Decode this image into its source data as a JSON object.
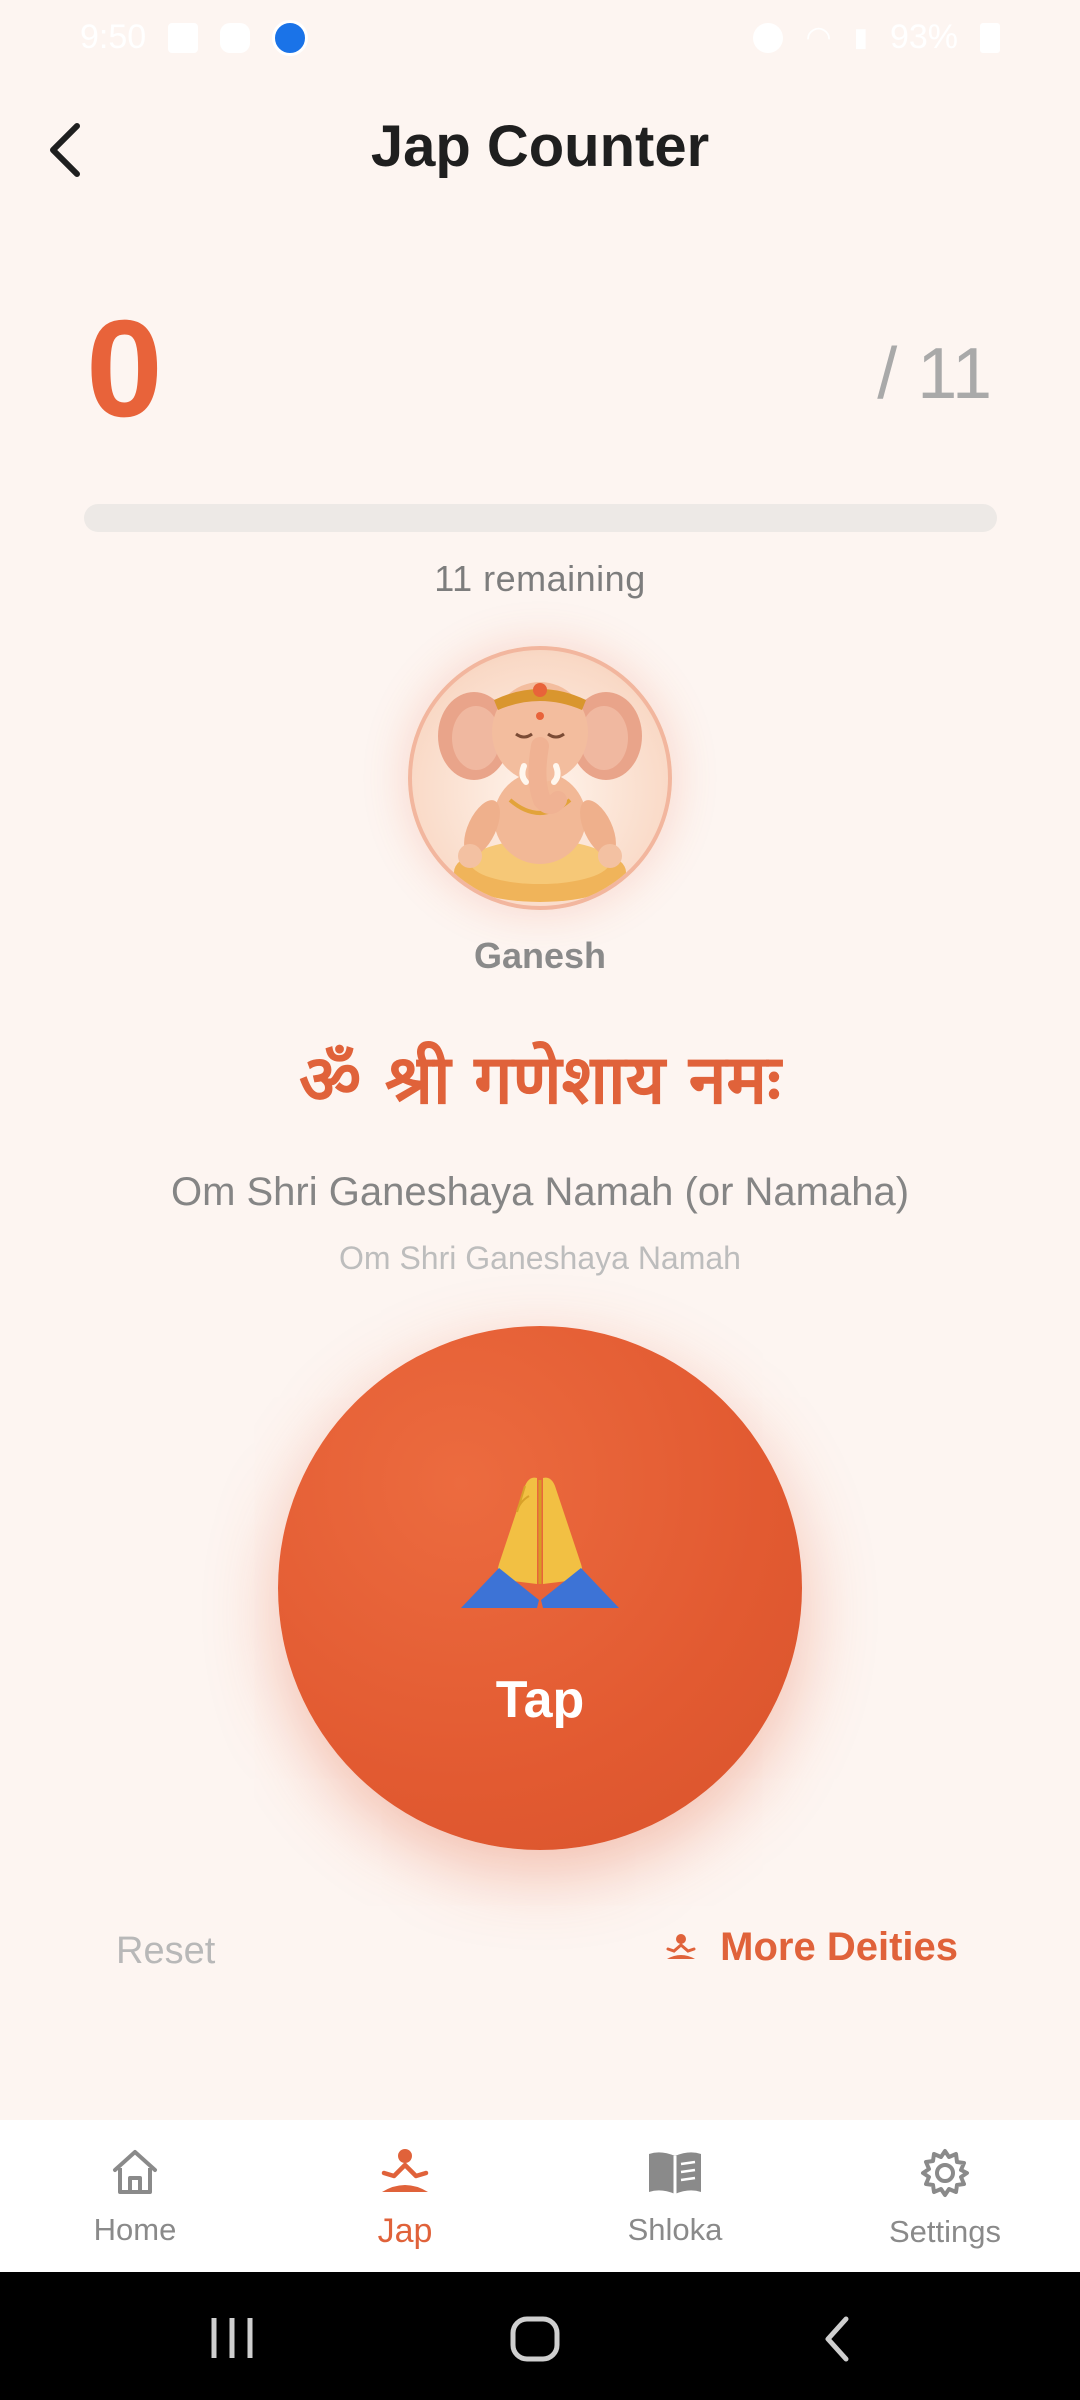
{
  "status_bar": {
    "time": "9:50",
    "battery": "93%"
  },
  "header": {
    "title": "Jap Counter"
  },
  "counter": {
    "count": "0",
    "target": "/ 11",
    "progress_fraction": 0.0,
    "remaining_text": "11 remaining"
  },
  "deity": {
    "name": "Ganesh"
  },
  "mantra": {
    "devanagari": "ॐ श्री गणेशाय नमः",
    "transliteration": "Om Shri Ganeshaya Namah (or Namaha)",
    "subtitle": "Om Shri Ganeshaya Namah"
  },
  "tap_button": {
    "label": "Tap"
  },
  "actions": {
    "reset_label": "Reset",
    "more_label": "More Deities"
  },
  "bottom_nav": {
    "items": [
      {
        "label": "Home",
        "icon": "home-icon",
        "active": false
      },
      {
        "label": "Jap",
        "icon": "meditation-icon",
        "active": true
      },
      {
        "label": "Shloka",
        "icon": "book-icon",
        "active": false
      },
      {
        "label": "Settings",
        "icon": "gear-icon",
        "active": false
      }
    ]
  },
  "colors": {
    "accent": "#e8633a",
    "background": "#fdf5f1",
    "muted": "#8a8a8a"
  }
}
